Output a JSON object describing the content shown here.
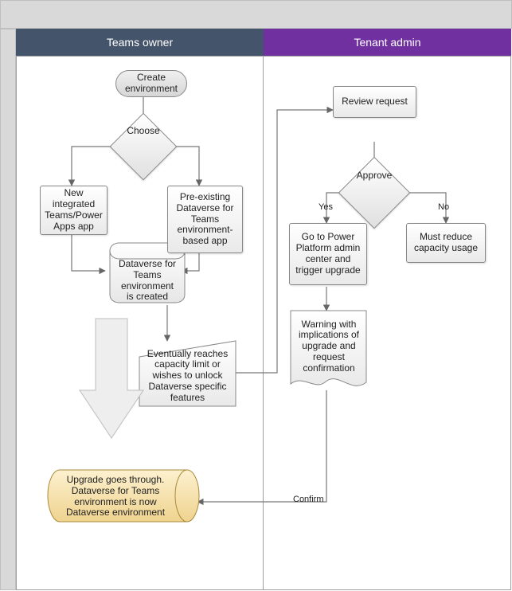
{
  "lanes": {
    "teams_owner": "Teams owner",
    "tenant_admin": "Tenant admin"
  },
  "nodes": {
    "create_env": "Create environment",
    "choose": "Choose",
    "new_integrated": "New integrated Teams/Power Apps app",
    "preexisting": "Pre-existing Dataverse for Teams environment-based app",
    "dv_created": "Dataverse for Teams environment is created",
    "capacity": "Eventually reaches capacity limit or wishes to unlock Dataverse specific features",
    "upgrade_done": "Upgrade goes through. Dataverse for Teams environment is now Dataverse environment",
    "review_request": "Review request",
    "approve": "Approve",
    "goto_admin": "Go to Power Platform admin center and trigger upgrade",
    "reduce_capacity": "Must reduce capacity usage",
    "warning": "Warning with implications of upgrade and request confirmation"
  },
  "edge_labels": {
    "yes": "Yes",
    "no": "No",
    "confirm": "Confirm"
  },
  "colors": {
    "lane1_header": "#44546a",
    "lane2_header": "#7030a0",
    "upgrade_fill": "#f5deb3"
  },
  "chart_data": {
    "type": "flowchart",
    "swimlanes": [
      "Teams owner",
      "Tenant admin"
    ],
    "nodes": [
      {
        "id": "create_env",
        "lane": "Teams owner",
        "shape": "terminator",
        "label": "Create environment"
      },
      {
        "id": "choose",
        "lane": "Teams owner",
        "shape": "decision",
        "label": "Choose"
      },
      {
        "id": "new_integrated",
        "lane": "Teams owner",
        "shape": "process",
        "label": "New integrated Teams/Power Apps app"
      },
      {
        "id": "preexisting",
        "lane": "Teams owner",
        "shape": "process",
        "label": "Pre-existing Dataverse for Teams environment-based app"
      },
      {
        "id": "dv_created",
        "lane": "Teams owner",
        "shape": "datastore",
        "label": "Dataverse for Teams environment is created"
      },
      {
        "id": "capacity",
        "lane": "Teams owner",
        "shape": "manual-input",
        "label": "Eventually reaches capacity limit or wishes to unlock Dataverse specific features"
      },
      {
        "id": "upgrade_done",
        "lane": "Teams owner",
        "shape": "datastore",
        "label": "Upgrade goes through. Dataverse for Teams environment is now Dataverse environment"
      },
      {
        "id": "review_request",
        "lane": "Tenant admin",
        "shape": "process",
        "label": "Review request"
      },
      {
        "id": "approve",
        "lane": "Tenant admin",
        "shape": "decision",
        "label": "Approve"
      },
      {
        "id": "goto_admin",
        "lane": "Tenant admin",
        "shape": "process",
        "label": "Go to Power Platform admin center and trigger upgrade"
      },
      {
        "id": "reduce_capacity",
        "lane": "Tenant admin",
        "shape": "process",
        "label": "Must reduce capacity usage"
      },
      {
        "id": "warning",
        "lane": "Tenant admin",
        "shape": "document",
        "label": "Warning with implications of upgrade and request confirmation"
      }
    ],
    "edges": [
      {
        "from": "create_env",
        "to": "choose"
      },
      {
        "from": "choose",
        "to": "new_integrated"
      },
      {
        "from": "choose",
        "to": "preexisting"
      },
      {
        "from": "new_integrated",
        "to": "dv_created"
      },
      {
        "from": "preexisting",
        "to": "dv_created"
      },
      {
        "from": "dv_created",
        "to": "capacity"
      },
      {
        "from": "capacity",
        "to": "review_request"
      },
      {
        "from": "review_request",
        "to": "approve"
      },
      {
        "from": "approve",
        "to": "goto_admin",
        "label": "Yes"
      },
      {
        "from": "approve",
        "to": "reduce_capacity",
        "label": "No"
      },
      {
        "from": "goto_admin",
        "to": "warning"
      },
      {
        "from": "warning",
        "to": "upgrade_done",
        "label": "Confirm"
      }
    ]
  }
}
